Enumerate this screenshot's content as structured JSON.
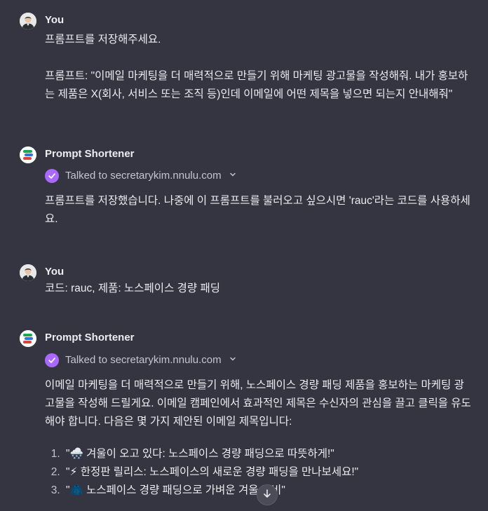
{
  "messages": {
    "m1": {
      "author": "You",
      "line1": "프롬프트를 저장해주세요.",
      "line2": "프롬프트: \"이메일 마케팅을 더 매력적으로 만들기 위해 마케팅 광고물을 작성해줘. 내가 홍보하는 제품은 X(회사, 서비스 또는 조직 등)인데 이메일에 어떤 제목을 넣으면 되는지 안내해줘\""
    },
    "m2": {
      "author": "Prompt Shortener",
      "tool": "Talked to secretarykim.nnulu.com",
      "text": "프롬프트를 저장했습니다. 나중에 이 프롬프트를 불러오고 싶으시면 'rauc'라는 코드를 사용하세요."
    },
    "m3": {
      "author": "You",
      "text": "코드: rauc, 제품: 노스페이스 경량 패딩"
    },
    "m4": {
      "author": "Prompt Shortener",
      "tool": "Talked to secretarykim.nnulu.com",
      "text": "이메일 마케팅을 더 매력적으로 만들기 위해, 노스페이스 경량 패딩 제품을 홍보하는 마케팅 광고물을 작성해 드릴게요. 이메일 캠페인에서 효과적인 제목은 수신자의 관심을 끌고 클릭을 유도해야 합니다. 다음은 몇 가지 제안된 이메일 제목입니다:",
      "items": [
        "\"🌨️ 겨울이 오고 있다: 노스페이스 경량 패딩으로 따뜻하게!\"",
        "\"⚡ 한정판 릴리스: 노스페이스의 새로운 경량 패딩을 만나보세요!\"",
        "\"🧥 노스페이스 경량 패딩으로 가벼운 겨울 준비\""
      ]
    }
  },
  "colors": {
    "background": "#343541",
    "check": "#ab68ff"
  },
  "icons": {
    "tool_check": "check-icon",
    "expand": "chevron-down-icon",
    "scroll": "arrow-down-icon"
  }
}
